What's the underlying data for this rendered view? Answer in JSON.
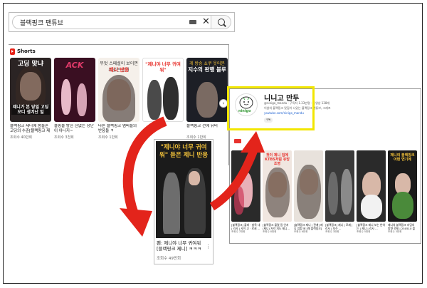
{
  "search": {
    "query": "블랙핑크 팬튜브"
  },
  "shorts": {
    "header": "Shorts",
    "cards": [
      {
        "caption": "고딩 맞냐",
        "subcaption": "",
        "caption2": "제니가 본 당일 고딩 오디 생겨난 일",
        "title": "블랙핑크 제니에 몸들흔 고딩의 수준[블랙핑크 제",
        "views": "조회수 40만회",
        "bg": "#2b2424",
        "cap_color": "#ffffff"
      },
      {
        "caption": "ACK",
        "subcaption": "",
        "caption2": "",
        "title": "블핑을 방한 한없는 장난이 아니지~",
        "views": "조회수 3천회",
        "bg": "#3a0f22",
        "cap_color": "#e23a6a"
      },
      {
        "caption": "제니 반응",
        "subcaption": "무엇 스페셜이 보이면 수많은 인기",
        "caption2": "",
        "title": "다른 블랙핑크 멤버들의 반응들 ㅋ",
        "views": "조회수 1만회",
        "bg": "#f5f0ea",
        "cap_color": "#e8322d"
      },
      {
        "caption": "\"제니야 너무 귀여워\"",
        "subcaption": "",
        "caption2": "",
        "title": "",
        "views": "",
        "bg": "#ffffff",
        "cap_color": "#e8322d"
      },
      {
        "caption": "지수의 판행 블루",
        "subcaption": "게 방송 쇼쿠 웃어본",
        "caption2": "",
        "title": "블랙핑크 전에 유비",
        "views": "조회수 1만회",
        "bg": "#1d1f26",
        "cap_color": "#ffffff"
      }
    ]
  },
  "zoom": {
    "caption": "\"제니야 너무 귀여워\" 듣은 제니 반응",
    "title": "팬: 제니야 너무 귀여워 [블랙핑크 제니] ㅋㅋㅋ",
    "views": "조회수 49만회"
  },
  "channel": {
    "name": "니니고 만두",
    "meta": "@ninigo_mandu · 구독자 1.33만명 · 동영상 138개",
    "desc": "이날의 블랙핑크 맛집이 나있는 블랙핑크 팬튜브, 그래프",
    "link": "youtube.com/ninigo_mandu",
    "subscribe": "구독",
    "avatar_label": "ninigo",
    "videos": [
      {
        "caption": "",
        "title": "[블랙핑크] 플레 · 방목 네 | 리사 | 사이 고 · 로세 ...",
        "views": "조회수 7만회",
        "bg": "#2a2a2a",
        "cap_color": "#ffffff"
      },
      {
        "caption": "첫이 제니 집에 KTBS처럼 유방 조영",
        "title": "[블랙핑크 몰렸 킹 인지 (제니) 저녁 지도 제니...",
        "views": "조회수 8만회",
        "bg": "#f0e6e0",
        "cap_color": "#e8322d"
      },
      {
        "caption": "",
        "title": "[블랙핑크 제니 | 관계] 제니 엄청 세 [해 블랙핑크]",
        "views": "조회수 6만회",
        "bg": "#e8e2dc",
        "cap_color": "#ffffff"
      },
      {
        "caption": "",
        "title": "[블랙핑크] 제니 | 로제 | 리사 | 지수 ...",
        "views": "조회수 3만회",
        "bg": "#3a3a3a",
        "cap_color": "#ffffff"
      },
      {
        "caption": "",
        "title": "[블랙핑크 제니 보는 반하는 | 제니 | 리사 ...",
        "views": "조회수 5만회",
        "bg": "#2a2a2a",
        "cap_color": "#ffffff"
      },
      {
        "caption": "제니의 블랙핑크 어떤 연기에",
        "title": "제니의 블랙핑크 리딩의 방향 로제 | 250510 블랙핑크 ...",
        "views": "조회수 3만회",
        "bg": "#1a1a1a",
        "cap_color": "#ffffff"
      },
      {
        "caption": "",
        "title": "제니 리사 로제 지수 블랙핑크 댄스 ...",
        "views": "조회수 3만회",
        "bg": "#c7b8e6",
        "cap_color": "#ffffff"
      }
    ]
  },
  "colors": {
    "arrow": "#e3241b",
    "highlight": "#f2e600",
    "accent": "#e8322d"
  }
}
